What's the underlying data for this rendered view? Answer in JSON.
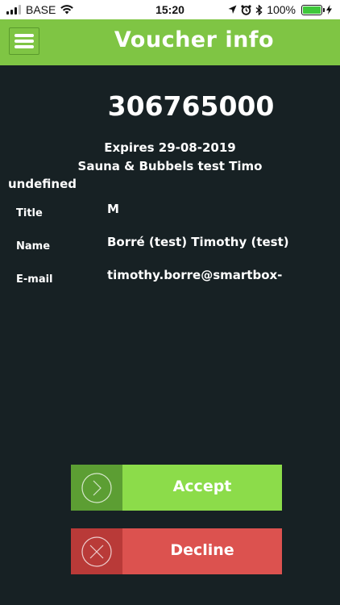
{
  "status_bar": {
    "carrier": "BASE",
    "time": "15:20",
    "battery": "100%",
    "battery_level": 1.0
  },
  "header": {
    "title": "Voucher info",
    "menu_icon": "hamburger-menu-icon",
    "color": "#7fc544"
  },
  "voucher": {
    "code": "306765000",
    "expires": "Expires 29-08-2019",
    "product": "Sauna & Bubbels test Timo"
  },
  "customer": {
    "heading": "undefined",
    "fields": [
      {
        "label": "Title",
        "value": "M"
      },
      {
        "label": "Name",
        "value": "Borré (test) Timothy (test)"
      },
      {
        "label": "E-mail",
        "value": "timothy.borre@smartbox-"
      }
    ]
  },
  "actions": {
    "accept_label": "Accept",
    "accept_color": "#8cdc4a",
    "decline_label": "Decline",
    "decline_color": "#dc524f"
  }
}
